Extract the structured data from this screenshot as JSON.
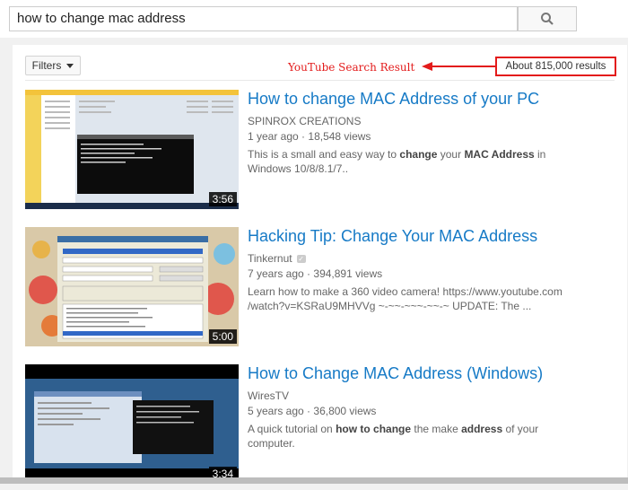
{
  "search": {
    "query": "how to change mac address"
  },
  "toolbar": {
    "filters_label": "Filters"
  },
  "annotation": {
    "text": "YouTube Search Result",
    "color": "#e31b1b"
  },
  "results_count": "About 815,000 results",
  "colors": {
    "title_link": "#167ac6",
    "annotation_red": "#e31b1b"
  },
  "results": [
    {
      "title": "How to change MAC Address of your PC",
      "channel": "SPINROX CREATIONS",
      "age": "1 year ago",
      "views": "18,548 views",
      "duration": "3:56",
      "desc_parts": [
        "This is a small and easy way to ",
        "change",
        " your ",
        "MAC Address",
        " in Windows 10/8/8.1/7.."
      ]
    },
    {
      "title": "Hacking Tip: Change Your MAC Address",
      "channel": "Tinkernut",
      "age": "7 years ago",
      "views": "394,891 views",
      "duration": "5:00",
      "desc_parts": [
        "Learn how to make a 360 video camera! https://www.youtube.com /watch?v=KSRaU9MHVVg ~-~~-~~~-~~-~ UPDATE: The ..."
      ]
    },
    {
      "title": "How to Change MAC Address (Windows)",
      "channel": "WiresTV",
      "age": "5 years ago",
      "views": "36,800 views",
      "duration": "3:34",
      "desc_parts": [
        "A quick tutorial on ",
        "how to change",
        " the make ",
        "address",
        " of your computer."
      ]
    }
  ],
  "icons": {
    "search": "search-icon",
    "filters": "chevron-down-icon",
    "verified": "verified-badge-icon"
  }
}
